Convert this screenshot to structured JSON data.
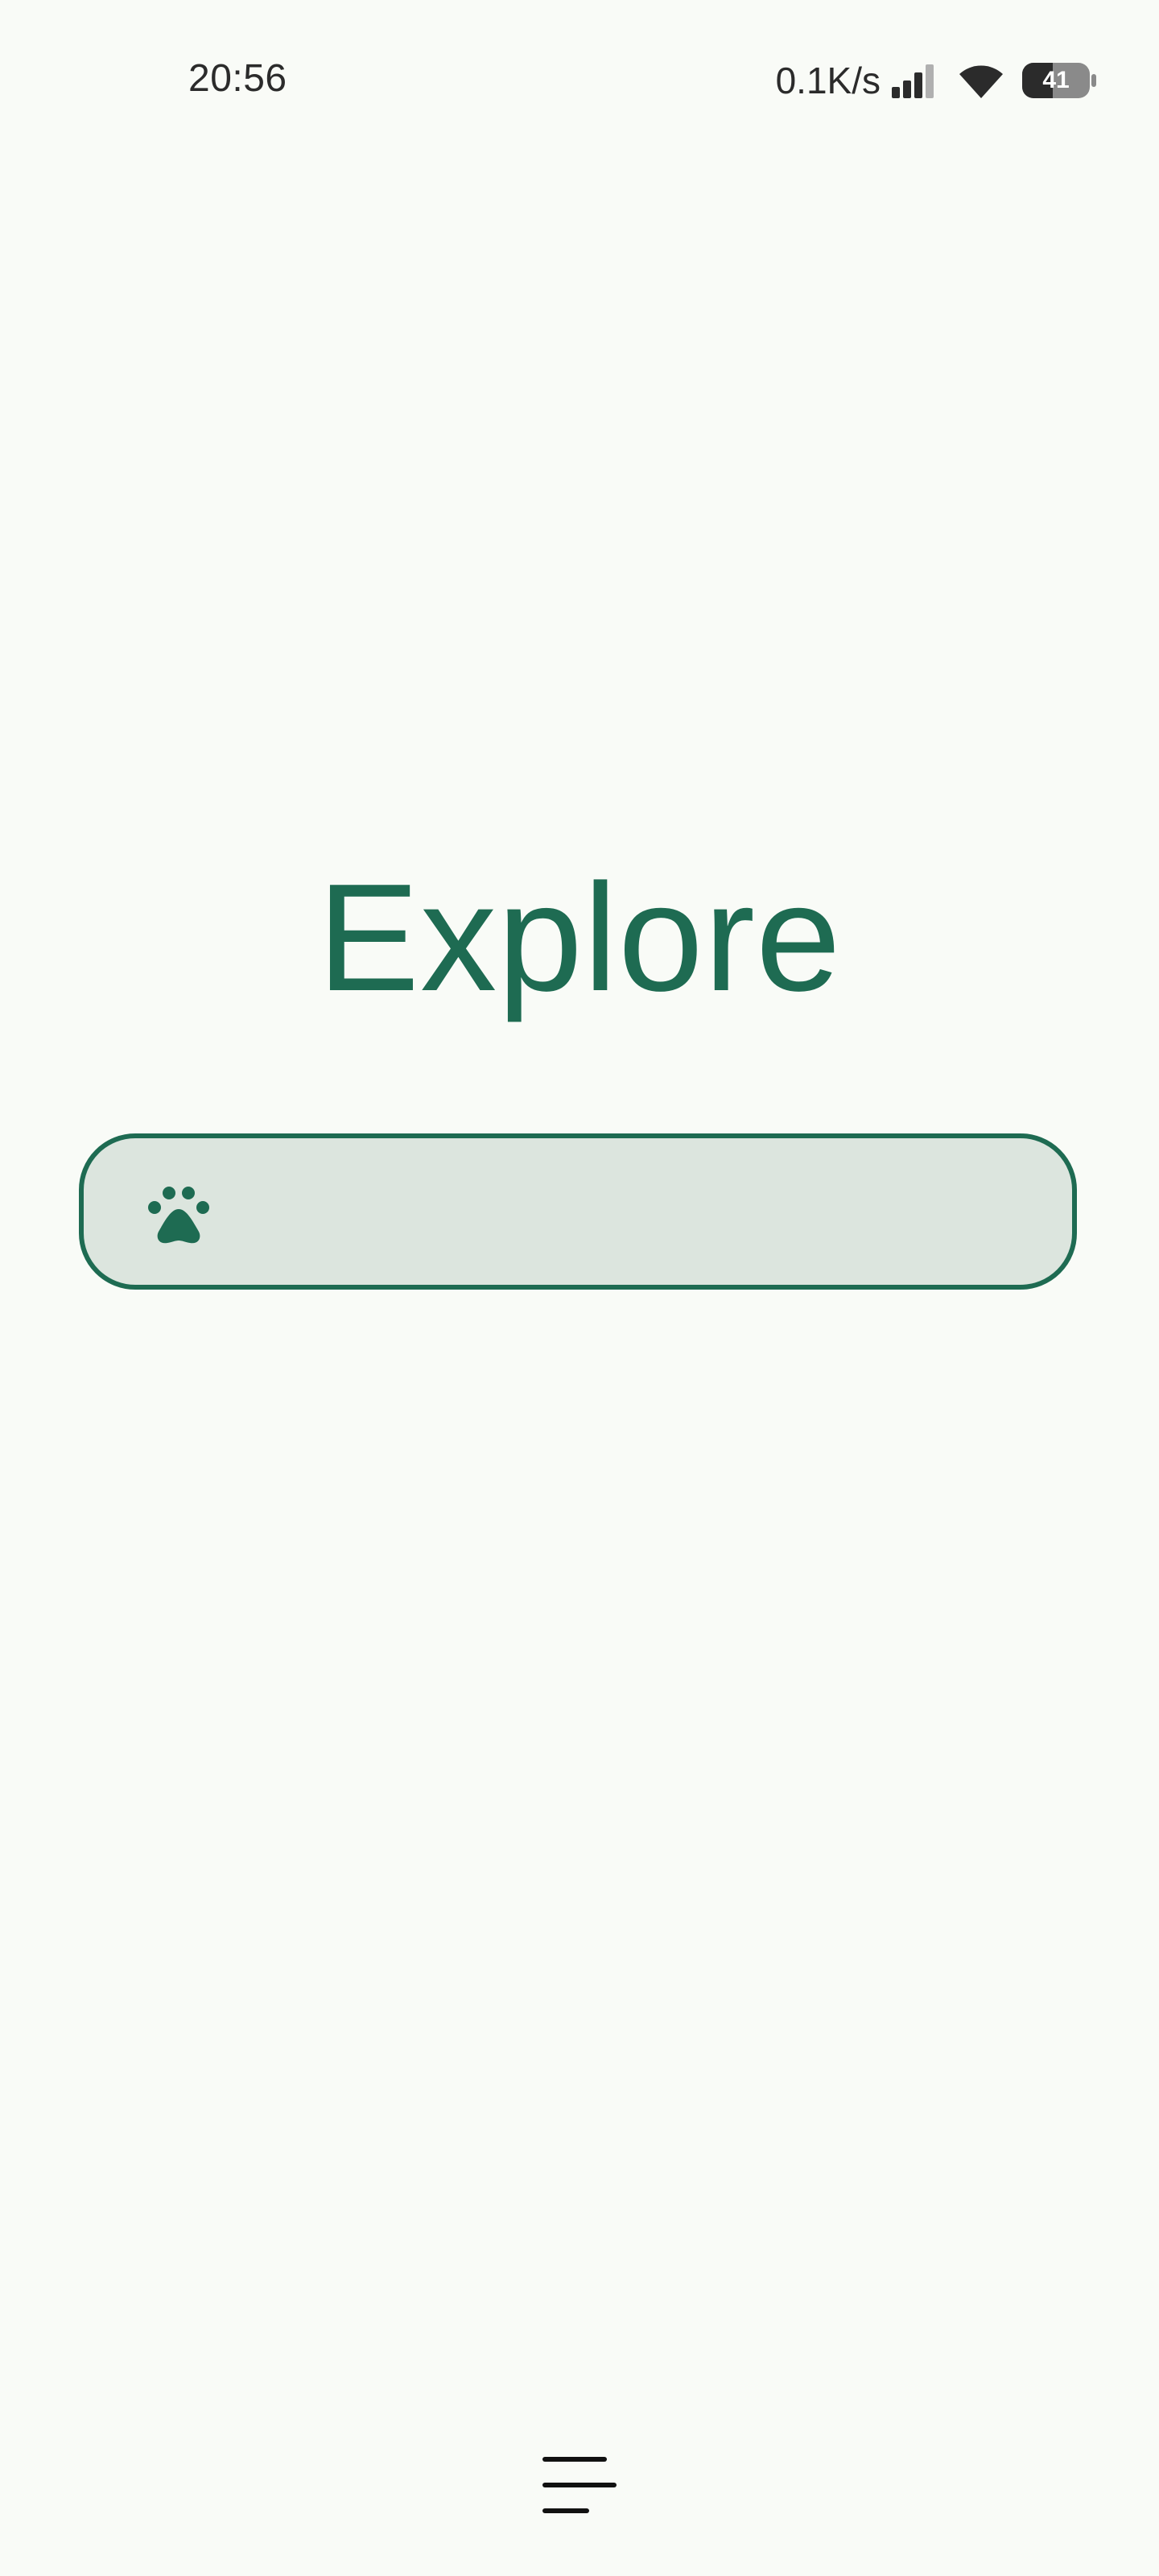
{
  "status_bar": {
    "time": "20:56",
    "net_speed": "0.1K/s",
    "battery_level": "41",
    "icons": [
      "signal-icon",
      "wifi-icon",
      "battery-icon"
    ]
  },
  "main": {
    "title": "Explore",
    "search": {
      "icon": "paw-icon",
      "value": "",
      "placeholder": ""
    }
  },
  "bottom_nav": {
    "icon": "menu-lines-icon"
  },
  "colors": {
    "accent": "#1e6b52",
    "search_fill": "#dce5de",
    "background": "#f9fbf7",
    "text_dark": "#2b2b2b"
  }
}
